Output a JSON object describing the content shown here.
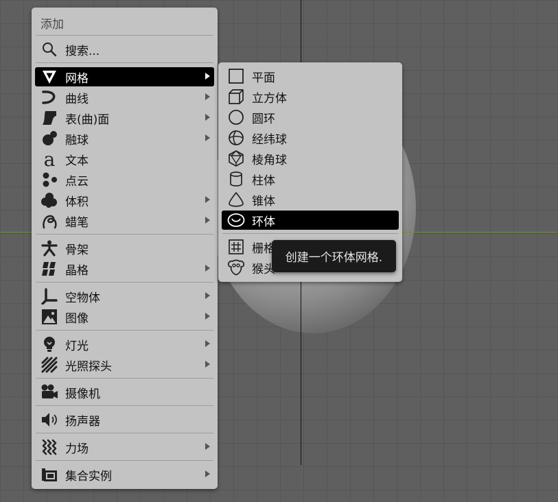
{
  "main_menu": {
    "title": "添加",
    "items": [
      {
        "label": "搜索...",
        "icon": "search-icon"
      },
      {
        "label": "网格",
        "icon": "mesh-icon"
      },
      {
        "label": "曲线",
        "icon": "curve-icon"
      },
      {
        "label": "表(曲)面",
        "icon": "surface-icon"
      },
      {
        "label": "融球",
        "icon": "metaball-icon"
      },
      {
        "label": "文本",
        "icon": "text-icon"
      },
      {
        "label": "点云",
        "icon": "point-cloud-icon"
      },
      {
        "label": "体积",
        "icon": "volume-icon"
      },
      {
        "label": "蜡笔",
        "icon": "grease-pencil-icon"
      },
      {
        "label": "骨架",
        "icon": "armature-icon"
      },
      {
        "label": "晶格",
        "icon": "lattice-icon"
      },
      {
        "label": "空物体",
        "icon": "empty-icon"
      },
      {
        "label": "图像",
        "icon": "image-icon"
      },
      {
        "label": "灯光",
        "icon": "light-icon"
      },
      {
        "label": "光照探头",
        "icon": "light-probe-icon"
      },
      {
        "label": "摄像机",
        "icon": "camera-icon"
      },
      {
        "label": "扬声器",
        "icon": "speaker-icon"
      },
      {
        "label": "力场",
        "icon": "force-field-icon"
      },
      {
        "label": "集合实例",
        "icon": "collection-instance-icon"
      }
    ]
  },
  "mesh_submenu": {
    "items": [
      {
        "label": "平面",
        "icon": "plane-icon"
      },
      {
        "label": "立方体",
        "icon": "cube-icon"
      },
      {
        "label": "圆环",
        "icon": "circle-icon"
      },
      {
        "label": "经纬球",
        "icon": "uv-sphere-icon"
      },
      {
        "label": "棱角球",
        "icon": "ico-sphere-icon"
      },
      {
        "label": "柱体",
        "icon": "cylinder-icon"
      },
      {
        "label": "锥体",
        "icon": "cone-icon"
      },
      {
        "label": "环体",
        "icon": "torus-icon"
      },
      {
        "label": "栅格",
        "icon": "grid-icon"
      },
      {
        "label": "猴头",
        "icon": "monkey-icon"
      }
    ]
  },
  "tooltip": {
    "text": "创建一个环体网格."
  },
  "colors": {
    "menu_bg": "#c3c3c3",
    "highlight": "#000000",
    "tooltip_bg": "#1b1b1b",
    "viewport_bg": "#5f5f5f"
  }
}
